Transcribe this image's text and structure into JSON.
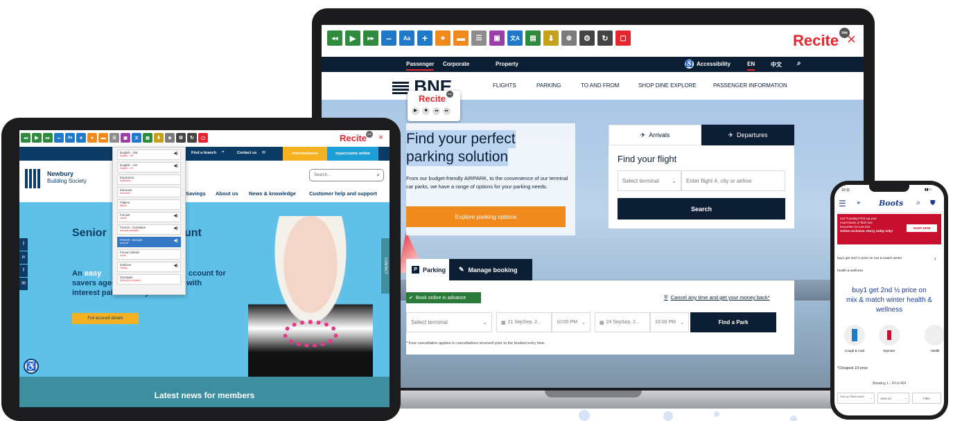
{
  "brand": {
    "recite": "Recite",
    "recite_me": "me",
    "close": "×"
  },
  "laptop": {
    "nav_top": {
      "tabs": [
        "Passenger",
        "Corporate",
        "Property"
      ],
      "accessibility": "Accessibility",
      "lang_en": "EN",
      "lang_zh": "中文"
    },
    "logo": "BNE",
    "nav_main": [
      "FLIGHTS",
      "PARKING",
      "TO AND FROM",
      "SHOP DINE EXPLORE",
      "PASSENGER INFORMATION"
    ],
    "popup": {
      "title": "Recite",
      "me": "me"
    },
    "hero": {
      "title_line1": "Find your perfect",
      "title_line2": "parking solution",
      "body": "From our budget-friendly AIRPARK, to the convenience of our terminal car parks, we have a range of options for your parking needs.",
      "cta": "Explore parking options"
    },
    "flight": {
      "tab_arrivals": "Arrivals",
      "tab_departures": "Departures",
      "heading": "Find your flight",
      "terminal_placeholder": "Select terminal",
      "flight_placeholder": "Enter flight #, city or airline",
      "search": "Search"
    },
    "parking": {
      "tab_parking": "Parking",
      "tab_manage": "Manage booking",
      "badge": "Book online in advance",
      "guarantee": "Cancel any time and get your money back*",
      "terminal": "Select terminal",
      "date1": "21 SepSep. 2...",
      "time1": "10:00 PM",
      "date2": "24 SepSep. 2...",
      "time2": "10:00 PM",
      "find": "Find a Park",
      "note": "* Free cancellation applies to cancellations received prior to the booked entry time."
    }
  },
  "tablet": {
    "topnav": {
      "find_branch": "Find a branch",
      "contact": "Contact us",
      "intermediaries": "Intermediaries",
      "myaccounts": "myaccounts online"
    },
    "logo_line1": "Newbury",
    "logo_line2": "Building Society",
    "search_placeholder": "Search...",
    "nav": [
      "Savings",
      "About us",
      "News & knowledge",
      "Customer help and support"
    ],
    "languages": [
      {
        "name": "English - GB",
        "native": "English - GB"
      },
      {
        "name": "English - US",
        "native": "English - US"
      },
      {
        "name": "Esperanto",
        "native": "Esperanto"
      },
      {
        "name": "Estonian",
        "native": "eesti keel"
      },
      {
        "name": "Filipino",
        "native": "filipino"
      },
      {
        "name": "Finnish",
        "native": "suomi"
      },
      {
        "name": "French - Canadian",
        "native": "français canadien"
      },
      {
        "name": "French - Europe",
        "native": "français"
      },
      {
        "name": "Frisian (West)",
        "native": "Frysk"
      },
      {
        "name": "Galician",
        "native": "Galego"
      },
      {
        "name": "Georgian",
        "native": "ქართული (Kartuli)"
      }
    ],
    "hero_title_a": "Senior",
    "hero_title_b": "unt",
    "hero_sub_a": "An",
    "hero_sub_b": "easy",
    "hero_sub_c": "ccount for",
    "hero_sub_line2": "savers aged 55 years and over, with",
    "hero_sub_line3": "interest paid monthly.",
    "cta": "Full account details",
    "contact_tab": "CONTACT",
    "social": [
      "f",
      "in",
      "f",
      "✉"
    ],
    "footer": "Latest news for members"
  },
  "phone": {
    "status_time": "10:11",
    "promo_line1": "£10 Tuesday! Pick up your",
    "promo_line2": "must-haves or find new",
    "promo_line3": "favourites for just £10.",
    "promo_bold": "Online exclusive. Hurry, today only!",
    "promo_btn": "SHOP NOW",
    "crumb": "buy1 get 2nd ½ price on mix & match winter health & wellness",
    "crumb_1": "buy1 get 2nd ½ price on mix & match winter",
    "crumb_2": "health & wellness",
    "heading_l1": "buy1 get 2nd ½ price on",
    "heading_l2": "mix & match winter health &",
    "heading_l3": "wellness",
    "categories": [
      "Cough & Cold",
      "Eyecare",
      "Health"
    ],
    "cheapest": "*Cheapest 1/2 price",
    "showing": "Showing 1 - 24 of 424",
    "sort": "Sort by: Best match",
    "view": "View 24",
    "filter": "Filter"
  },
  "colors": {
    "recite_red": "#e5262f",
    "navy": "#0c1e33",
    "orange": "#f08a1d",
    "green": "#2a7a3b",
    "boots_red": "#c8102e",
    "boots_blue": "#1a3b8f",
    "teal": "#3d8fa0"
  }
}
